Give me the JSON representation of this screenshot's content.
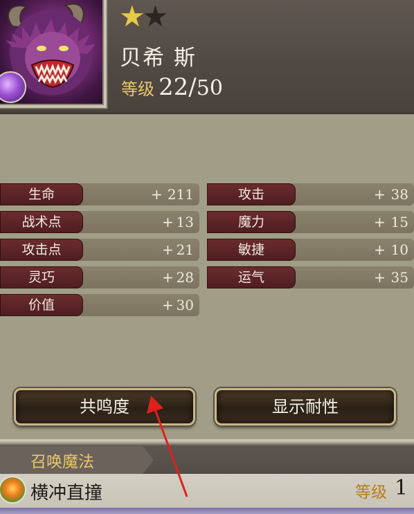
{
  "character": {
    "name": "贝希 斯",
    "rarity_filled": 1,
    "rarity_total": 2,
    "level_label": "等级",
    "level_current": "22",
    "level_separator": "/",
    "level_max": "50",
    "element_icon": "purple-orb-icon",
    "portrait_icon": "behemoth-portrait"
  },
  "stats_left": [
    {
      "label": "生命",
      "sign": "+",
      "value": "211"
    },
    {
      "label": "战术点",
      "sign": "+",
      "value": "13"
    },
    {
      "label": "攻击点",
      "sign": "+",
      "value": "21"
    },
    {
      "label": "灵巧",
      "sign": "+",
      "value": "28"
    },
    {
      "label": "价值",
      "sign": "+",
      "value": "30"
    }
  ],
  "stats_right": [
    {
      "label": "攻击",
      "sign": "+",
      "value": "38"
    },
    {
      "label": "魔力",
      "sign": "+",
      "value": "15"
    },
    {
      "label": "敏捷",
      "sign": "+",
      "value": "10"
    },
    {
      "label": "运气",
      "sign": "+",
      "value": "35"
    }
  ],
  "buttons": {
    "resonance": "共鸣度",
    "show_resistance": "显示耐性"
  },
  "summon": {
    "section_title": "召唤魔法",
    "skill_name": "横冲直撞",
    "skill_icon": "fire-skill-icon",
    "skill_level_label": "等级",
    "skill_level_value": "1"
  },
  "colors": {
    "panel_bg": "#a19d86",
    "header_bg": "#504842",
    "stat_label_bg": "#5a2427",
    "gold_text": "#e9c86a",
    "annotation_arrow": "#e0201c"
  }
}
